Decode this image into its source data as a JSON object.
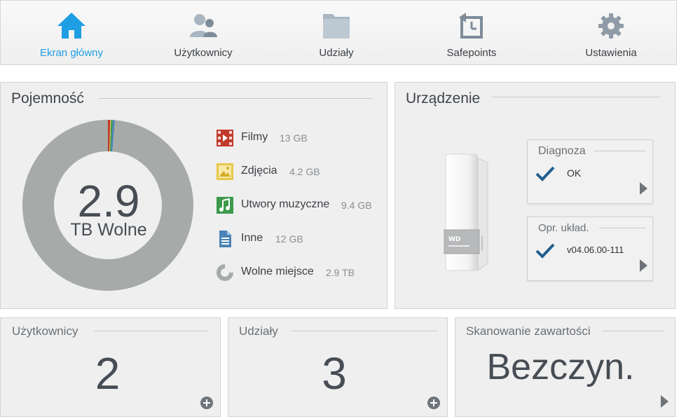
{
  "nav": {
    "items": [
      {
        "label": "Ekran główny",
        "icon": "home-icon",
        "active": true
      },
      {
        "label": "Użytkownicy",
        "icon": "users-icon",
        "active": false
      },
      {
        "label": "Udziały",
        "icon": "folder-icon",
        "active": false
      },
      {
        "label": "Safepoints",
        "icon": "safepoint-icon",
        "active": false
      },
      {
        "label": "Ustawienia",
        "icon": "gear-icon",
        "active": false
      }
    ]
  },
  "capacity": {
    "title": "Pojemność",
    "free_value": "2.9",
    "free_label": "TB Wolne",
    "legend": [
      {
        "name": "Filmy",
        "value": "13 GB",
        "icon": "film-icon",
        "color": "#c0392b"
      },
      {
        "name": "Zdjęcia",
        "value": "4.2 GB",
        "icon": "photo-icon",
        "color": "#e8c84a"
      },
      {
        "name": "Utwory muzyczne",
        "value": "9.4 GB",
        "icon": "music-icon",
        "color": "#3b9a4b"
      },
      {
        "name": "Inne",
        "value": "12 GB",
        "icon": "document-icon",
        "color": "#4a83b5"
      },
      {
        "name": "Wolne miejsce",
        "value": "2.9 TB",
        "icon": "free-space-icon",
        "color": "#a6aaa8"
      }
    ],
    "donut_fractions": {
      "Filmy": 0.0044,
      "Zdjęcia": 0.0014,
      "Utwory muzyczne": 0.0032,
      "Inne": 0.0041,
      "Wolne miejsce": 0.9869
    }
  },
  "device": {
    "title": "Urządzenie",
    "diagnosis": {
      "title": "Diagnoza",
      "status": "OK"
    },
    "firmware": {
      "title": "Opr. układ.",
      "version": "v04.06.00-111"
    }
  },
  "users": {
    "title": "Użytkownicy",
    "count": "2"
  },
  "shares": {
    "title": "Udziały",
    "count": "3"
  },
  "scan": {
    "title": "Skanowanie zawartości",
    "status": "Bezczyn."
  },
  "colors": {
    "accent": "#1e9ee3",
    "check": "#1f5f8f",
    "panel_bg": "#efefef",
    "donut_free": "#a6aaa8"
  }
}
